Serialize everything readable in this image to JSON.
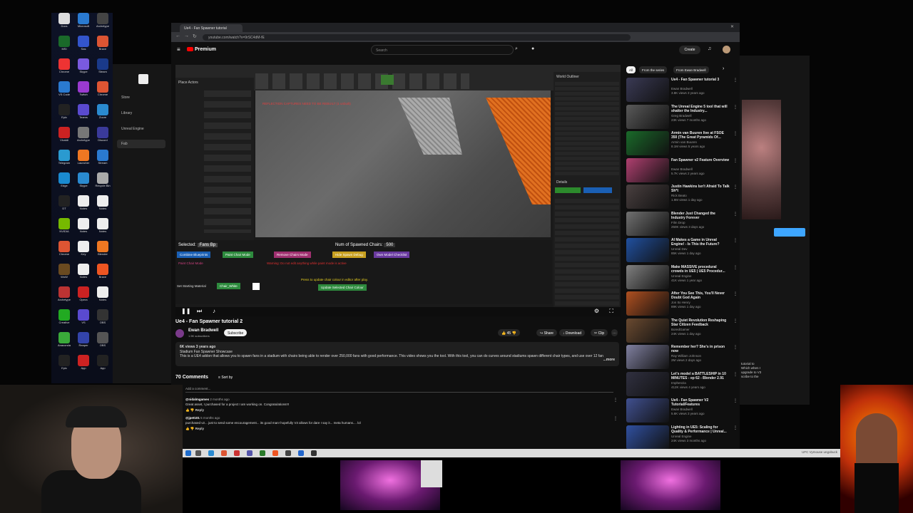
{
  "browser": {
    "tab_title": "Ue4 - Fan Spawner tutorial",
    "url": "youtube.com/watch?v=9rSC4dM-fE"
  },
  "youtube": {
    "logo": "Premium",
    "search_placeholder": "Search",
    "create_label": "Create"
  },
  "launcher": {
    "items": [
      "Store",
      "Library",
      "Unreal Engine",
      "Fab"
    ]
  },
  "desktop_icons": [
    "Docs",
    "Microsoft",
    "Archetype",
    "MSI",
    "Sas",
    "Brave",
    "Chrome",
    "Skype",
    "Steam",
    "VS Code",
    "Twitch",
    "Chrome",
    "Epic",
    "Teams",
    "Zoom",
    "Vivaldi",
    "Archetype",
    "Discord",
    "Telegram",
    "Launcher",
    "Stream",
    "Edge",
    "Skype",
    "Recycle Bin",
    "DT",
    "Notes",
    "Notes",
    "NVIDIA",
    "Notes",
    "Notes",
    "Chrome",
    "Key",
    "Blender",
    "WoW",
    "Notes",
    "Brave",
    "Archetype",
    "Opera",
    "Notes",
    "Creative",
    "VS",
    "OBS",
    "Anaconda",
    "Reaper",
    "OBS",
    "Epic",
    "App",
    "App"
  ],
  "ue_editor": {
    "place_actors": "Place Actors",
    "viewport_warning": "REFLECTION CAPTURES NEED TO BE REBUILT (1 unbuilt)",
    "selected_label": "Selected:",
    "selected_value": "Fans Bp",
    "spawned_label": "Num of Spawned Chairs:",
    "spawned_value": "500",
    "btn_combine": "Combine Blueprints",
    "btn_chair_mode": "Paint Chair Mode",
    "btn_remove": "Remove Chairs Mode",
    "btn_spawn": "Hide Spawn Debug",
    "btn_own_model": "Own Model Checklist",
    "paint_mode_label": "Paint Chair Mode",
    "warning_text": "Warning: Do not edit anything while paint mode is active",
    "press_update": "Press to update chair colour in editor after play.",
    "update_btn": "Update Selected Chair Colour",
    "starting_material_label": "Set Starting Material",
    "starting_material_value": "Chair_White",
    "outliner_label": "World Outliner",
    "details_label": "Details"
  },
  "video": {
    "title": "Ue4 - Fan Spawner tutorial 2",
    "channel": "Ewan Bradwell",
    "subscribers": "1.5K subscribers",
    "subscribe_label": "Subscribe",
    "likes": "45",
    "share": "Share",
    "download": "Download",
    "clip": "Clip",
    "views_date": "6K views  3 years ago",
    "desc_line1": "Stadium Fan Spawner Showcase",
    "desc_line2": "This is a UE4 addon that allows you to spawn fans in a stadium with chairs being able to render over 250,000 fans with good performance. This video shows you the tool. With this tool, you can do curves around stadiums spawn different chair types, and use over 12 fan",
    "more": "...more"
  },
  "comments": {
    "count": "70 Comments",
    "sort": "Sort by",
    "add_placeholder": "Add a comment...",
    "items": [
      {
        "author": "@nidalmgames",
        "age": "2 months ago",
        "text": "Great asset, I purchased for a project I am working on. Congratulations!!!",
        "reply": "Reply"
      },
      {
        "author": "@jpet101",
        "age": "5 months ago",
        "text": "purchased v2... just to send some encouragement... its good man! hopefully V3 allows for dare I say it... meta humans.... lol",
        "reply": "Reply"
      }
    ]
  },
  "sidebar_chips": [
    "All",
    "From the series",
    "From Ewan Bradwell"
  ],
  "recommendations": [
    {
      "title": "Ue4 - Fan Spawner tutorial 3",
      "channel": "Ewan Bradwell",
      "meta": "3.8K views  3 years ago",
      "color": "#3a3a55"
    },
    {
      "title": "The Unreal Engine 5 tool that will shatter the Industry...",
      "channel": "Greg Bradwell",
      "meta": "23K views  7 months ago",
      "color": "#5a5a5a"
    },
    {
      "title": "Armin van Buuren live at FSOE 350 (The Great Pyramids Of...",
      "channel": "Armin van Buuren",
      "meta": "8.1M views  5 years ago",
      "color": "#1a6a2a"
    },
    {
      "title": "Fan Spawner v2 Feature Overview",
      "channel": "Ewan Bradwell",
      "meta": "5.7K views  2 years ago",
      "color": "#b04070"
    },
    {
      "title": "Justin Hawkins Isn't Afraid To Talk Sh*t",
      "channel": "Rick Beato",
      "meta": "1.9M views  1 day ago",
      "color": "#4a4040"
    },
    {
      "title": "Blender Just Changed the Industry Forever",
      "channel": "Film Drop",
      "meta": "250K views  3 days ago",
      "color": "#707070"
    },
    {
      "title": "AI Makes a Game in Unreal Engine! - Is This the Future?",
      "channel": "Unreal Dev",
      "meta": "85K views  1 day ago",
      "color": "#2050a0"
    },
    {
      "title": "Make MASSIVE procedural crowds in UE5 | UE5 Procedur...",
      "channel": "Unreal Engine",
      "meta": "41K views  1 year ago",
      "color": "#808080"
    },
    {
      "title": "After You See This, You'll Never Doubt God Again",
      "channel": "Jon Ito Henry",
      "meta": "89K views  1 day ago",
      "color": "#b05020"
    },
    {
      "title": "The Quiet Revolution Reshaping Star Citizen Feedback",
      "channel": "BoredGamer",
      "meta": "24K views  1 day ago",
      "color": "#6a4a30"
    },
    {
      "title": "Remember her? She's in prison now",
      "channel": "Ray William Johnson",
      "meta": "2M views  2 days ago",
      "color": "#8080a0"
    },
    {
      "title": "Let's model a BATTLESHIP in 10 MINUTES - ep 62 - Blender 2.91",
      "channel": "Imphenzia",
      "meta": "412K views  4 years ago",
      "color": "#303040"
    },
    {
      "title": "Ue4 - Fan Spawner V2 Tutorial/Features",
      "channel": "Ewan Bradwell",
      "meta": "5.6K views  3 years ago",
      "color": "#405090"
    },
    {
      "title": "Lighting in UE5: Scaling for Quality & Performance | Unreal...",
      "channel": "Unreal Engine",
      "meta": "24K views  3 months ago",
      "color": "#3050a0"
    }
  ],
  "background_window": {
    "text1": "tutorial to",
    "text2": "Which when I",
    "text3": "upgrade to V3",
    "text4": "scribe to the"
  },
  "taskbar": {
    "tray": "UFC  Vymouse  ungobuck"
  }
}
